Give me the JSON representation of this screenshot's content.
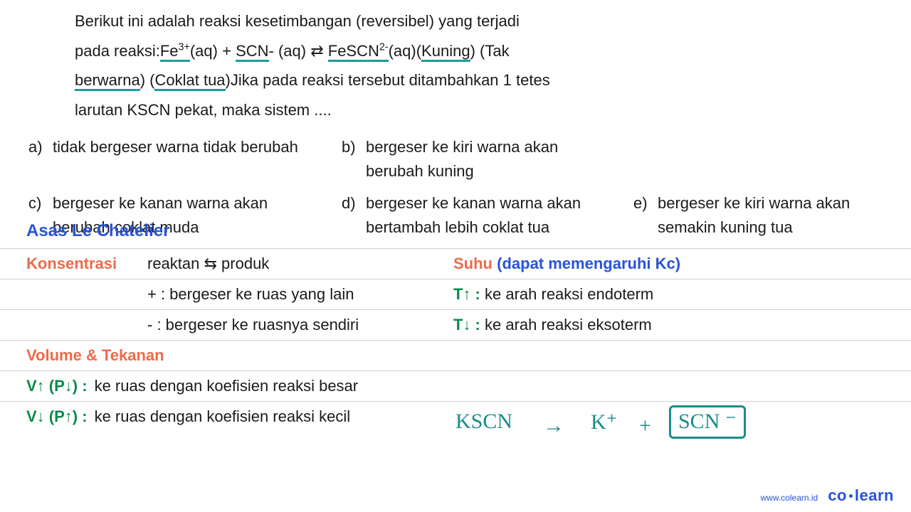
{
  "question": {
    "line1": "Berikut ini adalah reaksi kesetimbangan (reversibel) yang terjadi",
    "line2_pre": "pada reaksi:",
    "fe": "Fe",
    "fe_sup": "3+",
    "aq1": "(aq) + ",
    "scn": "SCN",
    "scn_post": "- (aq) ⇄ ",
    "fescn": "FeSCN",
    "fescn_sup": "2-",
    "aq2": "(aq)(",
    "kuning": "Kuning",
    "paren_end1": ") (",
    "tak": "Tak",
    "line3_pre": "",
    "berwarna": "berwarna",
    "mid3": ") (",
    "coklat": "Coklat tua",
    "line3_post": ")Jika pada reaksi tersebut ditambahkan 1 tetes",
    "line4": "larutan KSCN pekat, maka sistem ...."
  },
  "opts": {
    "a": {
      "l": "a)",
      "t": "tidak bergeser warna tidak berubah"
    },
    "b": {
      "l": "b)",
      "t": "bergeser ke kiri warna akan berubah kuning"
    },
    "c": {
      "l": "c)",
      "t": "bergeser ke kanan warna akan berubah coklat muda"
    },
    "d": {
      "l": "d)",
      "t": "bergeser ke kanan warna akan bertambah lebih coklat tua"
    },
    "e": {
      "l": "e)",
      "t": "bergeser ke kiri warna akan semakin kuning tua"
    }
  },
  "heading": "Asas Le Chatelier",
  "rules": {
    "konsentrasi_label": "Konsentrasi",
    "konsentrasi_eq": "reaktan ⇆ produk",
    "suhu_label": "Suhu",
    "suhu_note": "(dapat memengaruhi Kc)",
    "plus": "+ : bergeser ke ruas yang lain",
    "tup_pre": "T↑ :",
    "tup": " ke arah reaksi endoterm",
    "minus": "- : bergeser ke ruasnya sendiri",
    "tdn_pre": "T↓ :",
    "tdn": " ke arah reaksi eksoterm",
    "vt_label": "Volume & Tekanan",
    "vup_pre": "V↑ (P↓) :",
    "vup": " ke ruas dengan koefisien reaksi besar",
    "vdn_pre": "V↓ (P↑) :",
    "vdn": " ke ruas dengan koefisien reaksi kecil"
  },
  "hand": {
    "kscn": "KSCN",
    "arrow": "→",
    "k": "K⁺",
    "plus": "+",
    "scn": "SCN ⁻"
  },
  "footer": {
    "url": "www.colearn.id",
    "logo_co": "co",
    "logo_learn": "learn"
  }
}
